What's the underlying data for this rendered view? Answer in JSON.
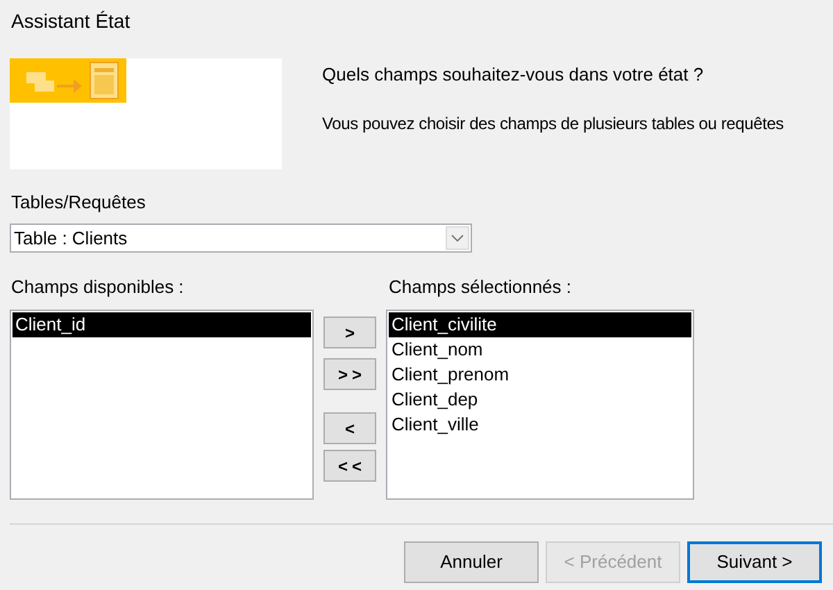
{
  "window": {
    "title": "Assistant État"
  },
  "intro": [
    "Quels champs souhaitez-vous dans votre état ?",
    "Vous pouvez choisir des champs de plusieurs tables ou requêtes"
  ],
  "source": {
    "label": "Tables/Requêtes",
    "value": "Table : Clients"
  },
  "available": {
    "label": "Champs disponibles :",
    "items": [
      {
        "text": "Client_id",
        "selected": true
      }
    ]
  },
  "move_buttons": [
    {
      "label": ">"
    },
    {
      "label": ">>"
    },
    {
      "label": "<"
    },
    {
      "label": "<<"
    }
  ],
  "chosen": {
    "label": "Champs sélectionnés :",
    "items": [
      {
        "text": "Client_civilite",
        "selected": true
      },
      {
        "text": "Client_nom",
        "selected": false
      },
      {
        "text": "Client_prenom",
        "selected": false
      },
      {
        "text": "Client_dep",
        "selected": false
      },
      {
        "text": "Client_ville",
        "selected": false
      }
    ]
  },
  "buttons": [
    {
      "label": "Annuler",
      "disabled": false,
      "default": false
    },
    {
      "label": "< Précédent",
      "disabled": true,
      "default": false
    },
    {
      "label": "Suivant >",
      "disabled": false,
      "default": true
    }
  ]
}
